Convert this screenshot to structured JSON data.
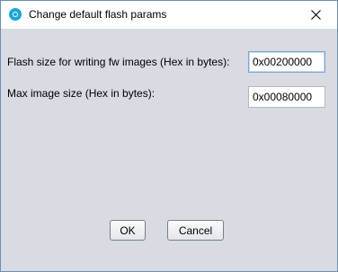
{
  "window": {
    "title": "Change default flash params",
    "app_icon": "app-logo-icon",
    "close_icon": "close-icon"
  },
  "form": {
    "flash_size_label": "Flash size for writing fw images (Hex in bytes):",
    "flash_size_value": "0x00200000",
    "image_size_label": "Max image size (Hex in bytes):",
    "image_size_value": "0x00080000"
  },
  "buttons": {
    "ok_label": "OK",
    "cancel_label": "Cancel"
  },
  "colors": {
    "dialog_background": "#d8dbe2",
    "titlebar_background": "#ffffff",
    "window_border": "#6b8fb8",
    "app_icon": "#1ba6d6",
    "focus_border": "#7aa7d6"
  }
}
